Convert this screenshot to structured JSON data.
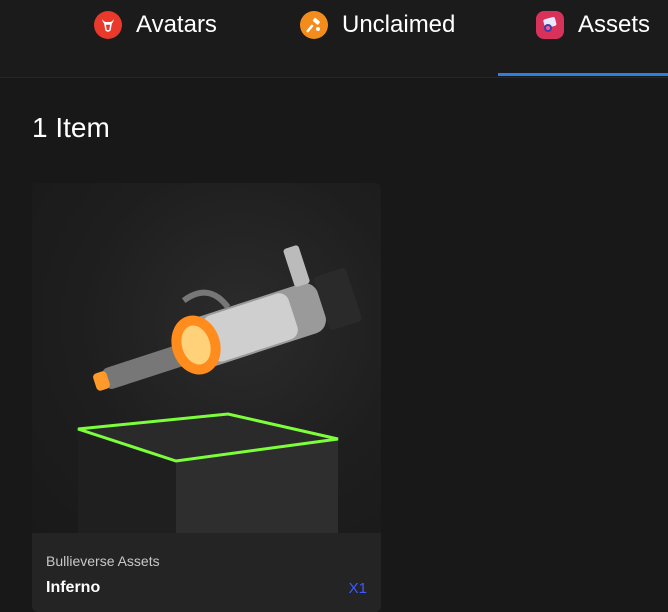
{
  "tabs": [
    {
      "label": "Avatars",
      "icon": "bull-head-icon",
      "color": "#e8392b"
    },
    {
      "label": "Unclaimed",
      "icon": "hammer-icon",
      "color": "#f28c1c"
    },
    {
      "label": "Assets",
      "icon": "assets-cube-icon",
      "color": "#d8325a"
    }
  ],
  "active_tab": "Assets",
  "accent_color": "#2f7fe0",
  "item_count_title": "1 Item",
  "items": [
    {
      "collection": "Bullieverse Assets",
      "name": "Inferno",
      "quantity": "X1",
      "image": "minigun-weapon-on-pedestal",
      "glow_color": "#7cff3a"
    }
  ]
}
